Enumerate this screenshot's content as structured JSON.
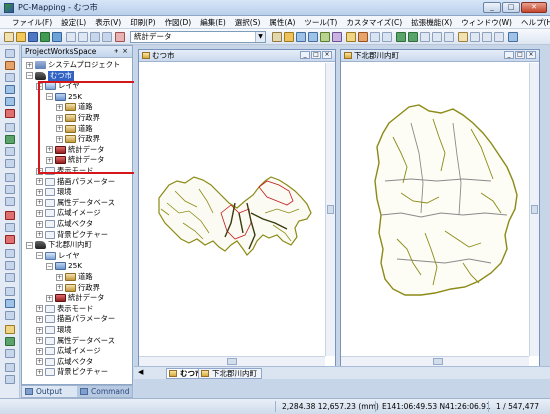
{
  "app": {
    "title": "PC-Mapping - むつ市"
  },
  "window_buttons": {
    "minimize": "_",
    "maximize": "□",
    "close": "✕"
  },
  "menu": [
    "ファイル(F)",
    "設定(L)",
    "表示(V)",
    "印刷(P)",
    "作図(D)",
    "編集(E)",
    "選択(S)",
    "属性(A)",
    "ツール(T)",
    "カスタマイズ(C)",
    "拡張機能(X)",
    "ウィンドウ(W)",
    "ヘルプ(H)"
  ],
  "toolbar": {
    "layer_select_value": "統計データ"
  },
  "tree": {
    "title": "ProjectWorksSpace",
    "pin": "ᚐ",
    "close": "×",
    "nodes": [
      {
        "label": "システムプロジェクト",
        "exp": "+",
        "icon": "project",
        "indent": 0
      },
      {
        "label": "むつ市",
        "exp": "−",
        "icon": "area",
        "indent": 0,
        "selected": true
      },
      {
        "label": "レイヤ",
        "exp": "−",
        "icon": "layer",
        "indent": 1
      },
      {
        "label": "25K",
        "exp": "−",
        "icon": "folder",
        "indent": 2
      },
      {
        "label": "道路",
        "exp": "+",
        "icon": "road",
        "indent": 3
      },
      {
        "label": "行政界",
        "exp": "+",
        "icon": "road",
        "indent": 3
      },
      {
        "label": "道路",
        "exp": "+",
        "icon": "road",
        "indent": 3
      },
      {
        "label": "行政界",
        "exp": "+",
        "icon": "road",
        "indent": 3
      },
      {
        "label": "統計データ",
        "exp": "+",
        "icon": "stat",
        "indent": 2
      },
      {
        "label": "統計データ",
        "exp": "+",
        "icon": "stat",
        "indent": 2
      },
      {
        "label": "表示モード",
        "exp": "+",
        "icon": "item",
        "indent": 1
      },
      {
        "label": "描画パラメーター",
        "exp": "+",
        "icon": "item",
        "indent": 1
      },
      {
        "label": "環境",
        "exp": "+",
        "icon": "item",
        "indent": 1
      },
      {
        "label": "属性データベース",
        "exp": "+",
        "icon": "item",
        "indent": 1
      },
      {
        "label": "広域イメージ",
        "exp": "+",
        "icon": "item",
        "indent": 1
      },
      {
        "label": "広域ベクタ",
        "exp": "+",
        "icon": "item",
        "indent": 1
      },
      {
        "label": "背景ピクチャー",
        "exp": "+",
        "icon": "item",
        "indent": 1
      },
      {
        "label": "下北郡川内町",
        "exp": "−",
        "icon": "area",
        "indent": 0
      },
      {
        "label": "レイヤ",
        "exp": "−",
        "icon": "layer",
        "indent": 1
      },
      {
        "label": "25K",
        "exp": "−",
        "icon": "folder",
        "indent": 2
      },
      {
        "label": "道路",
        "exp": "+",
        "icon": "road",
        "indent": 3
      },
      {
        "label": "行政界",
        "exp": "+",
        "icon": "road",
        "indent": 3
      },
      {
        "label": "統計データ",
        "exp": "+",
        "icon": "stat",
        "indent": 2
      },
      {
        "label": "表示モード",
        "exp": "+",
        "icon": "item",
        "indent": 1
      },
      {
        "label": "描画パラメーター",
        "exp": "+",
        "icon": "item",
        "indent": 1
      },
      {
        "label": "環境",
        "exp": "+",
        "icon": "item",
        "indent": 1
      },
      {
        "label": "属性データベース",
        "exp": "+",
        "icon": "item",
        "indent": 1
      },
      {
        "label": "広域イメージ",
        "exp": "+",
        "icon": "item",
        "indent": 1
      },
      {
        "label": "広域ベクタ",
        "exp": "+",
        "icon": "item",
        "indent": 1
      },
      {
        "label": "背景ピクチャー",
        "exp": "+",
        "icon": "item",
        "indent": 1
      }
    ]
  },
  "panel_tabs": {
    "output": "Output",
    "command": "Command"
  },
  "map_windows": [
    {
      "title": "むつ市"
    },
    {
      "title": "下北郡川内町"
    }
  ],
  "doc_tabs": [
    "むつ市",
    "下北郡川内町"
  ],
  "status": {
    "coords": "2,284.38  12,657.23  (mm)",
    "latlon": "E141:06:49.53  N41:26:06.91",
    "count": "1 / 547,477"
  },
  "colors": {
    "roads": "#8b8a16",
    "boundary_red": "#c21a1a",
    "boundary_gray": "#8a8a8a",
    "selection": "#3163c5",
    "highlight": "#d3171b"
  }
}
